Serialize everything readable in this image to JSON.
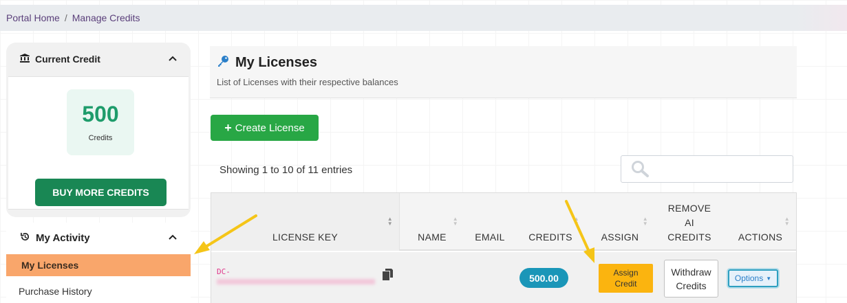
{
  "breadcrumb": {
    "home": "Portal Home",
    "separator": "/",
    "current": "Manage Credits"
  },
  "sidebar": {
    "current_credit": {
      "title": "Current Credit",
      "amount": "500",
      "unit": "Credits",
      "buy_label": "BUY MORE CREDITS"
    },
    "activity": {
      "title": "My Activity",
      "items": [
        {
          "label": "My Licenses",
          "active": true
        },
        {
          "label": "Purchase History",
          "active": false
        }
      ]
    }
  },
  "main": {
    "title": "My Licenses",
    "subtitle": "List of Licenses with their respective balances",
    "create_label": "Create License",
    "showing_text": "Showing 1 to 10 of 11 entries",
    "search": {
      "placeholder": ""
    },
    "table": {
      "columns": [
        {
          "label": "LICENSE KEY"
        },
        {
          "label": "NAME"
        },
        {
          "label": "EMAIL"
        },
        {
          "label": "CREDITS"
        },
        {
          "label": "ASSIGN"
        },
        {
          "label": "REMOVE AI CREDITS"
        },
        {
          "label": "ACTIONS"
        }
      ],
      "rows": [
        {
          "license_prefix": "DC-",
          "name": "",
          "email": "",
          "credits": "500.00",
          "assign_label": "Assign Credit",
          "withdraw_label": "Withdraw Credits",
          "options_label": "Options"
        }
      ]
    }
  },
  "colors": {
    "buy_button": "#198754",
    "create_button": "#28a745",
    "active_nav": "#f9a66b",
    "credits_badge": "#1a96b8",
    "assign_button": "#fbb40f",
    "annotation_arrow": "#f5c518"
  }
}
